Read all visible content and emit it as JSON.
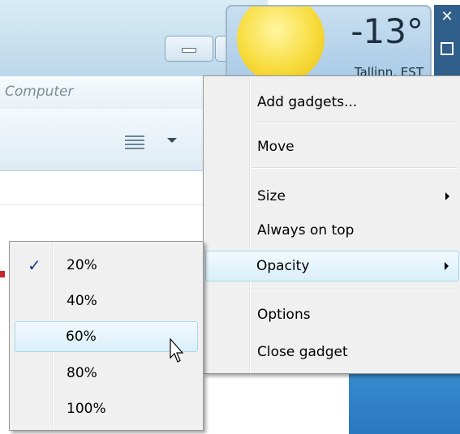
{
  "explorer": {
    "breadcrumb": "Computer"
  },
  "weather_gadget": {
    "temperature": "-13°",
    "city": "Tallinn, EST"
  },
  "context_menu": {
    "items": [
      {
        "label": "Add gadgets..."
      },
      {
        "label": "Move"
      },
      {
        "label": "Size",
        "has_submenu": true
      },
      {
        "label": "Always on top"
      },
      {
        "label": "Opacity",
        "has_submenu": true,
        "highlighted": true
      },
      {
        "label": "Options"
      },
      {
        "label": "Close gadget"
      }
    ]
  },
  "opacity_submenu": {
    "items": [
      {
        "label": "20%",
        "checked": true
      },
      {
        "label": "40%"
      },
      {
        "label": "60%",
        "hovered": true
      },
      {
        "label": "80%"
      },
      {
        "label": "100%"
      }
    ]
  },
  "colors": {
    "menu_bg": "#f0f0f0",
    "highlight_border": "#a8d8eb",
    "check": "#1b3f82"
  }
}
